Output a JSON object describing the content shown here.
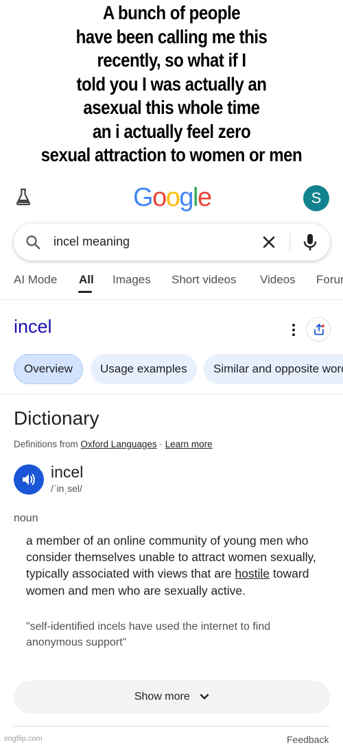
{
  "caption": {
    "lines": [
      "A bunch of people",
      "have been calling me this",
      "recently, so what if I",
      "told you I was actually an",
      "asexual this whole time",
      "an i actually feel zero",
      "sexual attraction to women or men"
    ]
  },
  "header": {
    "logo_letters": [
      "G",
      "o",
      "o",
      "g",
      "l",
      "e"
    ],
    "avatar_letter": "S",
    "icons": {
      "labs": "flask-icon"
    }
  },
  "search": {
    "query": "incel meaning",
    "icons": {
      "search": "search-icon",
      "clear": "close-icon",
      "voice": "mic-icon"
    }
  },
  "tabs": [
    "AI Mode",
    "All",
    "Images",
    "Short videos",
    "Videos",
    "Forums"
  ],
  "tabs_active": "All",
  "result": {
    "title": "incel",
    "chips": [
      "Overview",
      "Usage examples",
      "Similar and opposite words"
    ],
    "active_chip": "Overview"
  },
  "dictionary": {
    "heading": "Dictionary",
    "defs_prefix": "Definitions from ",
    "source": "Oxford Languages",
    "separator": " · ",
    "learn_more": "Learn more",
    "headword": "incel",
    "phonetic": "/ˈinˌsel/",
    "part_of_speech": "noun",
    "definition_before": "a member of an online community of young men who consider themselves unable to attract women sexually, typically associated with views that are ",
    "definition_link": "hostile",
    "definition_after": " toward women and men who are sexually active.",
    "example": "\"self-identified incels have used the internet to find anonymous support\""
  },
  "footer": {
    "show_more": "Show more",
    "feedback": "Feedback",
    "watermark": "imgflip.com"
  },
  "colors": {
    "link_blue": "#1a0dab",
    "speaker_blue": "#1a56d6",
    "chip_bg": "#e8f0fe",
    "avatar": "#11838f"
  }
}
